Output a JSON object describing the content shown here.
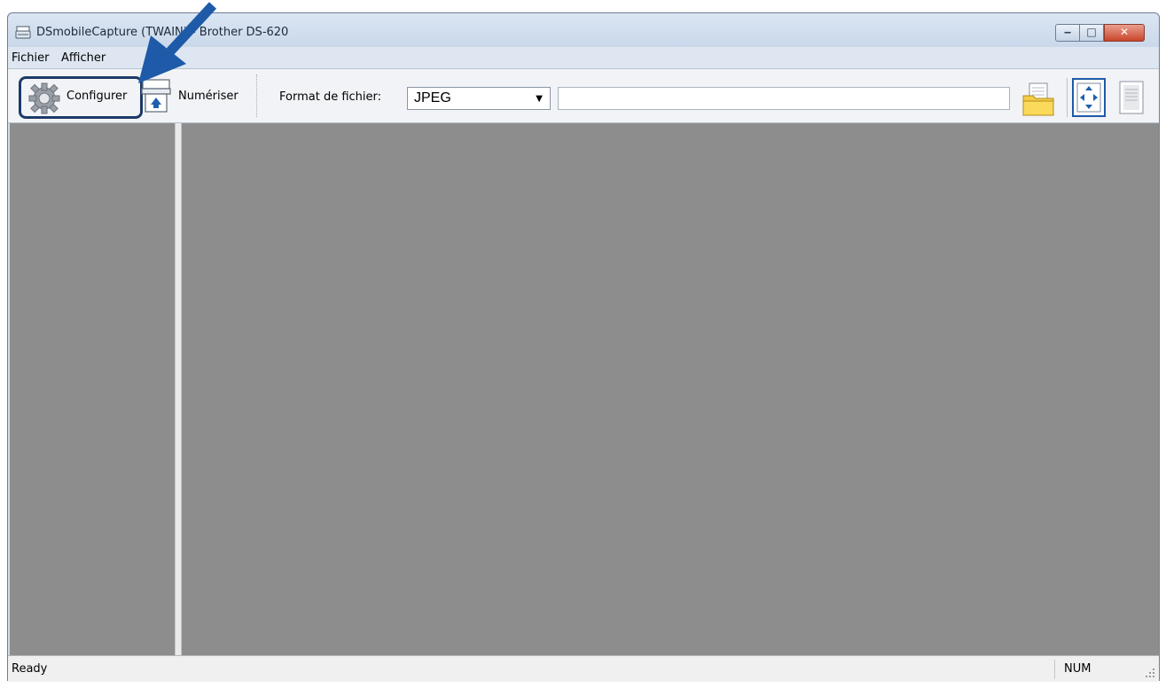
{
  "window": {
    "title": "DSmobileCapture (TWAIN) - Brother DS-620",
    "controls": {
      "minimize": "‒",
      "maximize": "□",
      "close": "✕"
    }
  },
  "menu": [
    "Fichier",
    "Afficher"
  ],
  "toolbar": {
    "configure_label": "Configurer",
    "scan_label": "Numériser",
    "format_label": "Format de fichier:",
    "format_value": "JPEG",
    "path_value": ""
  },
  "status": {
    "text": "Ready",
    "num": "NUM"
  },
  "colors": {
    "annotation_arrow": "#1e5aa8",
    "annotation_box": "#1c3a68",
    "pane_bg": "#8d8d8d"
  },
  "icons": {
    "app": "scanner-icon",
    "configure": "gear-icon",
    "scan": "scanner-feed-icon",
    "folder": "folder-icon",
    "fit": "fit-to-window-icon",
    "page": "single-page-icon"
  }
}
